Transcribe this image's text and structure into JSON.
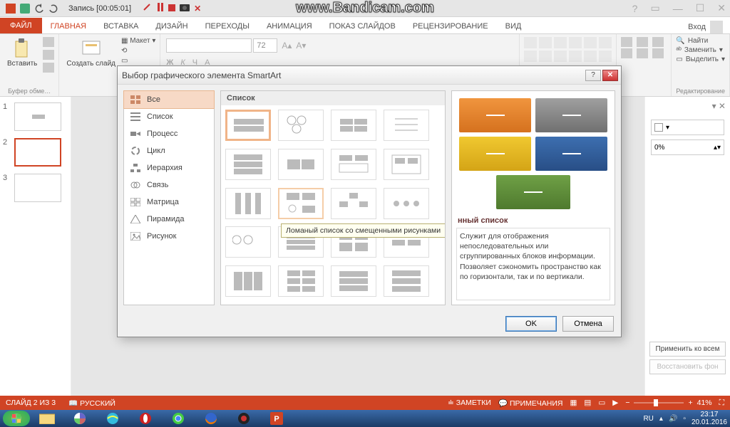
{
  "titlebar": {
    "recording": "Запись [00:05:01]"
  },
  "banner": "www.Bandicam.com",
  "window": {
    "login": "Вход"
  },
  "tabs": {
    "file": "ФАЙЛ",
    "home": "ГЛАВНАЯ",
    "insert": "ВСТАВКА",
    "design": "ДИЗАЙН",
    "transitions": "ПЕРЕХОДЫ",
    "anim": "АНИМАЦИЯ",
    "show": "ПОКАЗ СЛАЙДОВ",
    "review": "РЕЦЕНЗИРОВАНИЕ",
    "view": "ВИД"
  },
  "ribbon": {
    "clipboard": {
      "paste": "Вставить",
      "group": "Буфер обме…"
    },
    "slides": {
      "new": "Создать слайд",
      "layout": "Макет"
    },
    "font": {
      "size": "72",
      "group": ""
    },
    "editing": {
      "find": "Найти",
      "replace": "Заменить",
      "select": "Выделить",
      "group": "Редактирование"
    }
  },
  "thumbs": [
    "1",
    "2",
    "3"
  ],
  "dialog": {
    "title": "Выбор графического элемента SmartArt",
    "cats": {
      "all": "Все",
      "list": "Список",
      "process": "Процесс",
      "cycle": "Цикл",
      "hierarchy": "Иерархия",
      "relationship": "Связь",
      "matrix": "Матрица",
      "pyramid": "Пирамида",
      "picture": "Рисунок"
    },
    "gallery_header": "Список",
    "tooltip": "Ломаный список со смещенными рисунками",
    "preview_title": "нный список",
    "preview_desc": "Служит для отображения непоследовательных или сгруппированных блоков информации. Позволяет сэкономить пространство как по горизонтали, так и по вертикали.",
    "ok": "OK",
    "cancel": "Отмена"
  },
  "right_panel": {
    "percent": "0%",
    "apply_all": "Применить ко всем",
    "reset_bg": "Восстановить фон"
  },
  "status": {
    "slide": "СЛАЙД 2 ИЗ 3",
    "lang": "РУССКИЙ",
    "notes": "ЗАМЕТКИ",
    "comments": "ПРИМЕЧАНИЯ",
    "zoom": "41%"
  },
  "taskbar": {
    "lang": "RU",
    "time": "23:17",
    "date": "20.01.2016"
  },
  "colors": {
    "accent": "#d04424",
    "orange": "#e27a2b",
    "gray": "#8b8b8b",
    "yellow": "#e4b82a",
    "blue": "#2f5e9e",
    "green": "#5a8a3a"
  }
}
